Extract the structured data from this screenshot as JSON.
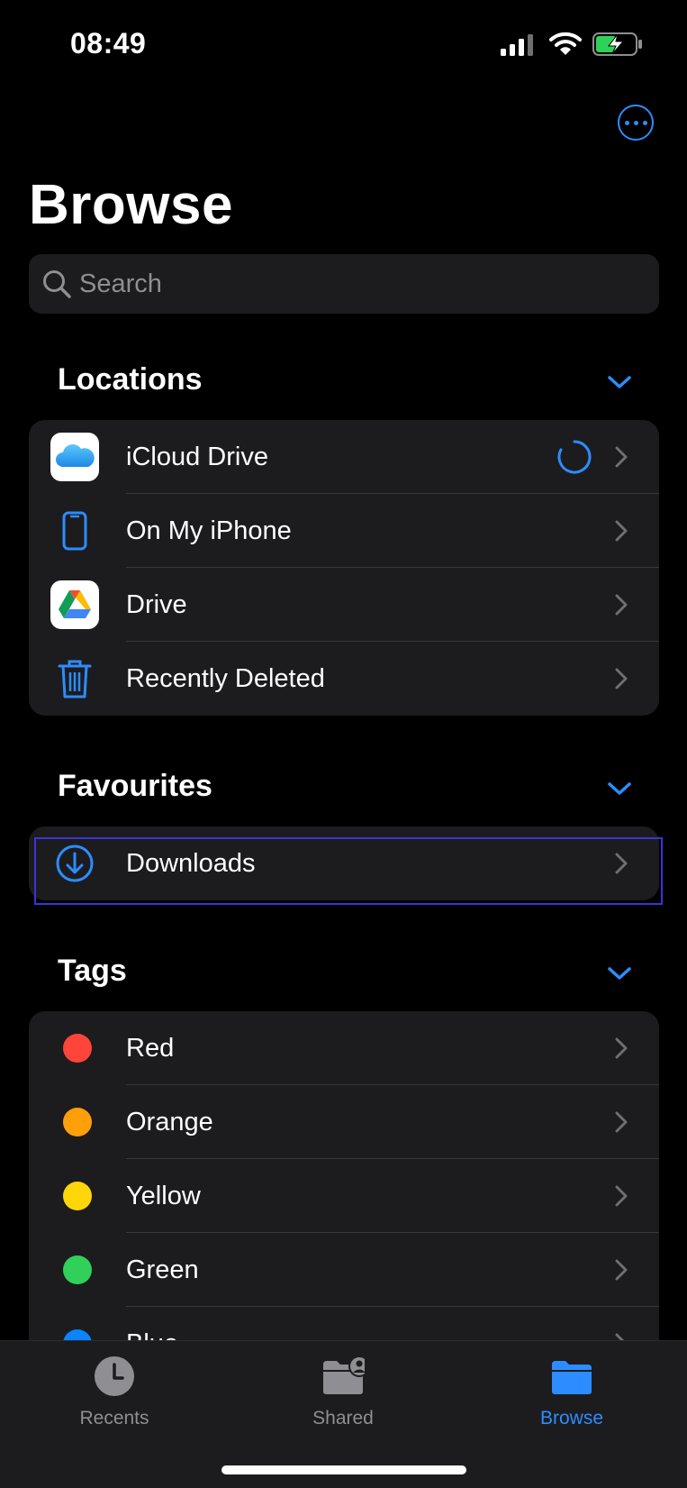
{
  "status": {
    "time": "08:49"
  },
  "header": {
    "title": "Browse",
    "more_icon": "ellipsis-circle-icon"
  },
  "search": {
    "placeholder": "Search"
  },
  "sections": {
    "locations": "Locations",
    "favourites": "Favourites",
    "tags": "Tags"
  },
  "locations": [
    {
      "label": "iCloud Drive",
      "icon": "icloud-icon",
      "status": "syncing"
    },
    {
      "label": "On My iPhone",
      "icon": "iphone-icon"
    },
    {
      "label": "Drive",
      "icon": "google-drive-icon"
    },
    {
      "label": "Recently Deleted",
      "icon": "trash-icon"
    }
  ],
  "favourites": [
    {
      "label": "Downloads",
      "icon": "download-circle-icon"
    }
  ],
  "tags": [
    {
      "label": "Red",
      "color": "#ff453a"
    },
    {
      "label": "Orange",
      "color": "#ff9f0a"
    },
    {
      "label": "Yellow",
      "color": "#ffd60a"
    },
    {
      "label": "Green",
      "color": "#30d158"
    },
    {
      "label": "Blue",
      "color": "#0a84ff"
    }
  ],
  "tabbar": [
    {
      "label": "Recents",
      "icon": "clock-icon",
      "active": false
    },
    {
      "label": "Shared",
      "icon": "shared-folder-icon",
      "active": false
    },
    {
      "label": "Browse",
      "icon": "folder-icon",
      "active": true
    }
  ],
  "colors": {
    "accent": "#2d8cff",
    "background": "#000000",
    "cell": "#1c1c1e"
  }
}
